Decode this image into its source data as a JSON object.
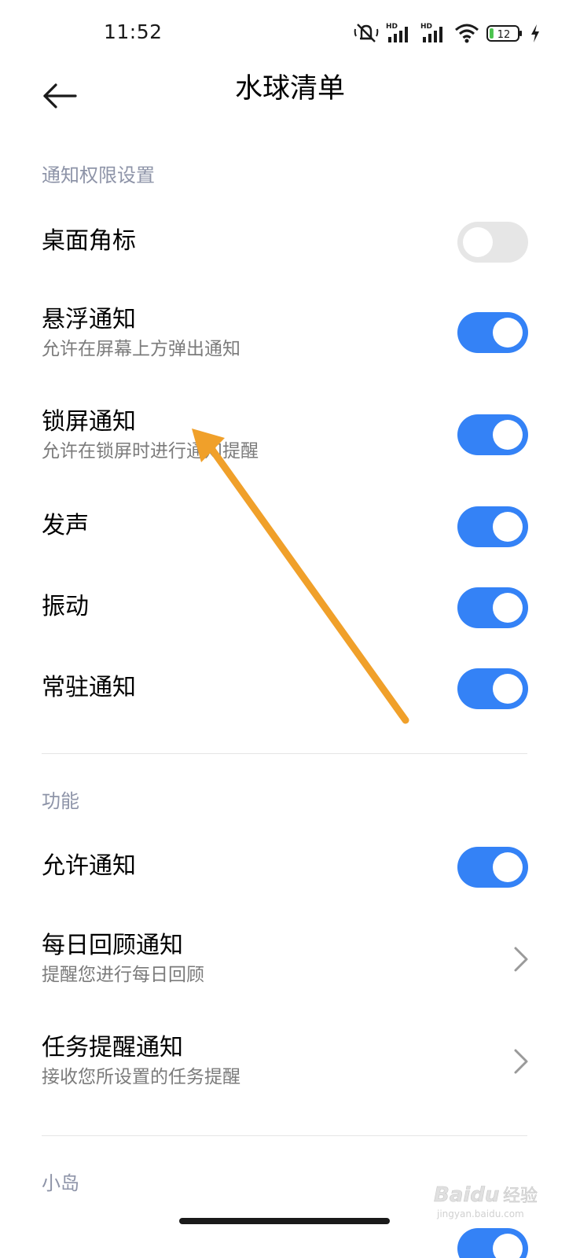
{
  "status_bar": {
    "time": "11:52",
    "icons": [
      "muted-icon",
      "hd-signal-1-icon",
      "hd-signal-2-icon",
      "wifi-icon",
      "battery-icon",
      "charging-icon"
    ],
    "hd_label": "HD",
    "battery_level": "12",
    "battery_level_fraction": 0.12
  },
  "header": {
    "title": "水球清单",
    "back_icon": "arrow-left-icon"
  },
  "sections": [
    {
      "header": "通知权限设置",
      "rows": [
        {
          "title": "桌面角标",
          "subtitle": "",
          "control": "toggle",
          "on": false
        },
        {
          "title": "悬浮通知",
          "subtitle": "允许在屏幕上方弹出通知",
          "control": "toggle",
          "on": true
        },
        {
          "title": "锁屏通知",
          "subtitle": "允许在锁屏时进行通知提醒",
          "control": "toggle",
          "on": true
        },
        {
          "title": "发声",
          "subtitle": "",
          "control": "toggle",
          "on": true
        },
        {
          "title": "振动",
          "subtitle": "",
          "control": "toggle",
          "on": true
        },
        {
          "title": "常驻通知",
          "subtitle": "",
          "control": "toggle",
          "on": true
        }
      ]
    },
    {
      "header": "功能",
      "rows": [
        {
          "title": "允许通知",
          "subtitle": "",
          "control": "toggle",
          "on": true
        },
        {
          "title": "每日回顾通知",
          "subtitle": "提醒您进行每日回顾",
          "control": "chevron"
        },
        {
          "title": "任务提醒通知",
          "subtitle": "接收您所设置的任务提醒",
          "control": "chevron"
        }
      ]
    },
    {
      "header": "小岛",
      "rows": []
    }
  ],
  "colors": {
    "toggle_on": "#3482f6",
    "toggle_off": "#e6e6e6",
    "section_header": "#8e94a8",
    "subtitle": "#7b7b7b",
    "annotation_arrow": "#f0a02a"
  },
  "watermark": {
    "brand": "Baidu",
    "label": "经验",
    "url": "jingyan.baidu.com"
  }
}
